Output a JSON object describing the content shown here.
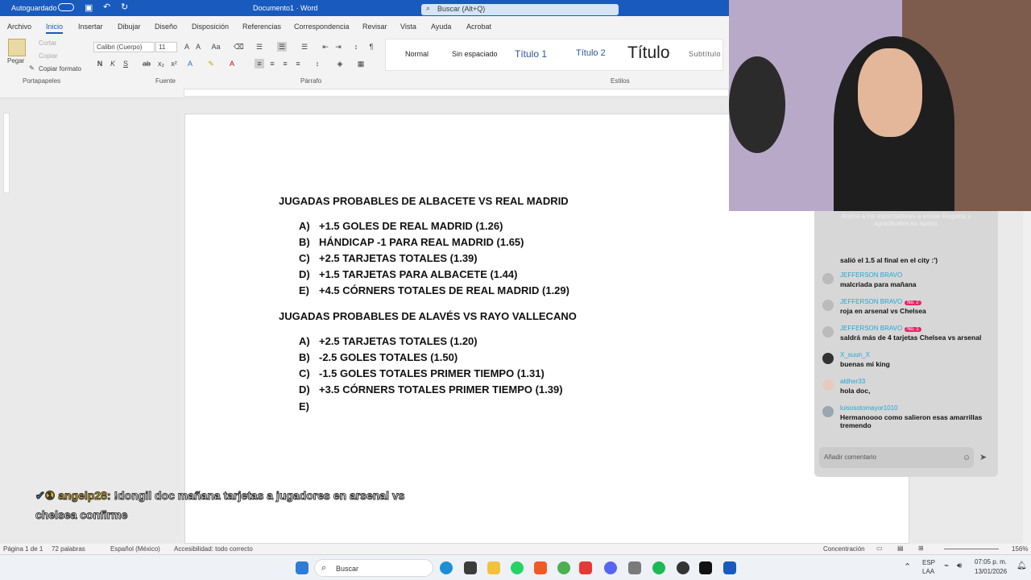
{
  "titlebar": {
    "left_text": "Autoguardado",
    "doc_name": "Documento1 · Word",
    "search_placeholder": "Buscar (Alt+Q)"
  },
  "menu": {
    "tabs": [
      "Archivo",
      "Inicio",
      "Insertar",
      "Dibujar",
      "Diseño",
      "Disposición",
      "Referencias",
      "Correspondencia",
      "Revisar",
      "Vista",
      "Ayuda",
      "Acrobat"
    ],
    "active": "Inicio"
  },
  "ribbon": {
    "clipboard": {
      "paste": "Pegar",
      "cut": "Cortar",
      "copy": "Copiar",
      "format_painter": "Copiar formato",
      "label": "Portapapeles"
    },
    "font": {
      "name": "Calibri (Cuerpo)",
      "size": "11",
      "label": "Fuente"
    },
    "paragraph": {
      "label": "Párrafo"
    },
    "styles": {
      "items": [
        "Normal",
        "Sin espaciado",
        "Título 1",
        "Título 2",
        "Título",
        "Subtítulo"
      ],
      "label": "Estilos"
    }
  },
  "document": {
    "heading1": "JUGADAS PROBABLES DE ALBACETE VS REAL MADRID",
    "list1": [
      {
        "letter": "A)",
        "text": "+1.5 GOLES DE REAL MADRID (1.26)"
      },
      {
        "letter": "B)",
        "text": "HÁNDICAP -1 PARA REAL MADRID (1.65)"
      },
      {
        "letter": "C)",
        "text": "+2.5 TARJETAS TOTALES (1.39)"
      },
      {
        "letter": "D)",
        "text": "+1.5 TARJETAS PARA ALBACETE (1.44)"
      },
      {
        "letter": "E)",
        "text": "+4.5 CÓRNERS TOTALES DE REAL MADRID (1.29)"
      }
    ],
    "heading2": "JUGADAS PROBABLES DE ALAVÉS VS RAYO VALLECANO",
    "list2": [
      {
        "letter": "A)",
        "text": "+2.5 TARJETAS TOTALES (1.20)"
      },
      {
        "letter": "B)",
        "text": "-2.5 GOLES TOTALES (1.50)"
      },
      {
        "letter": "C)",
        "text": "-1.5 GOLES TOTALES PRIMER TIEMPO (1.31)"
      },
      {
        "letter": "D)",
        "text": "+3.5 CÓRNERS TOTALES PRIMER TIEMPO (1.39)"
      },
      {
        "letter": "E)",
        "text": ""
      }
    ]
  },
  "overlay": {
    "user": "angelp28:",
    "message": "!dongil doc mañana tarjetas a jugadores en arsenal vs chelsea confirme"
  },
  "chat": {
    "header": "Anima a los espectadores a enviar Regalos y agradéceles su apoyo.",
    "messages": [
      {
        "name": "",
        "msg": "salió el 1.5 al final en el city :')",
        "badge": ""
      },
      {
        "name": "JEFFERSON BRAVO",
        "msg": "malcriada para mañana",
        "badge": ""
      },
      {
        "name": "JEFFERSON BRAVO",
        "msg": "roja en arsenal vs Chelsea",
        "badge": "No. 2"
      },
      {
        "name": "JEFFERSON BRAVO",
        "msg": "saldrá más de 4 tarjetas Chelsea vs arsenal",
        "badge": "No. 1"
      },
      {
        "name": "X_suun_X",
        "msg": "buenas mi king",
        "badge": ""
      },
      {
        "name": "aldher33",
        "msg": "hola doc,",
        "badge": ""
      },
      {
        "name": "luisosotomayor1010",
        "msg": "Hermanoooo como salieron esas amarrillas tremendo",
        "badge": ""
      }
    ],
    "input_placeholder": "Añadir comentario"
  },
  "status": {
    "page": "Página 1 de 1",
    "words": "72 palabras",
    "lang": "Español (México)",
    "access": "Accesibilidad: todo correcto",
    "focus": "Concentración",
    "zoom": "156%"
  },
  "taskbar": {
    "search": "Buscar",
    "lang1": "ESP",
    "lang2": "LAA",
    "time": "07:05 p. m.",
    "date": "13/01/2026"
  }
}
